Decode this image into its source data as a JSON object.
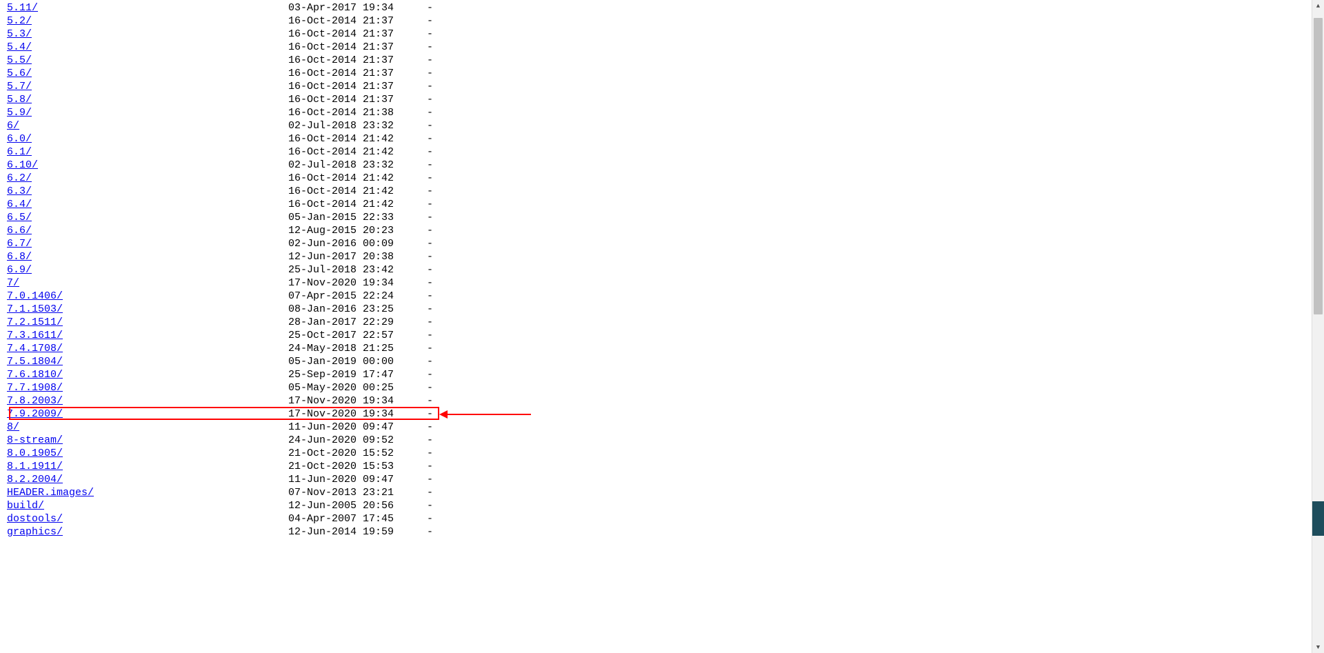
{
  "listing": [
    {
      "name": "5.11/",
      "date": "03-Apr-2017 19:34",
      "size": "-",
      "highlighted": false
    },
    {
      "name": "5.2/",
      "date": "16-Oct-2014 21:37",
      "size": "-",
      "highlighted": false
    },
    {
      "name": "5.3/",
      "date": "16-Oct-2014 21:37",
      "size": "-",
      "highlighted": false
    },
    {
      "name": "5.4/",
      "date": "16-Oct-2014 21:37",
      "size": "-",
      "highlighted": false
    },
    {
      "name": "5.5/",
      "date": "16-Oct-2014 21:37",
      "size": "-",
      "highlighted": false
    },
    {
      "name": "5.6/",
      "date": "16-Oct-2014 21:37",
      "size": "-",
      "highlighted": false
    },
    {
      "name": "5.7/",
      "date": "16-Oct-2014 21:37",
      "size": "-",
      "highlighted": false
    },
    {
      "name": "5.8/",
      "date": "16-Oct-2014 21:37",
      "size": "-",
      "highlighted": false
    },
    {
      "name": "5.9/",
      "date": "16-Oct-2014 21:38",
      "size": "-",
      "highlighted": false
    },
    {
      "name": "6/",
      "date": "02-Jul-2018 23:32",
      "size": "-",
      "highlighted": false
    },
    {
      "name": "6.0/",
      "date": "16-Oct-2014 21:42",
      "size": "-",
      "highlighted": false
    },
    {
      "name": "6.1/",
      "date": "16-Oct-2014 21:42",
      "size": "-",
      "highlighted": false
    },
    {
      "name": "6.10/",
      "date": "02-Jul-2018 23:32",
      "size": "-",
      "highlighted": false
    },
    {
      "name": "6.2/",
      "date": "16-Oct-2014 21:42",
      "size": "-",
      "highlighted": false
    },
    {
      "name": "6.3/",
      "date": "16-Oct-2014 21:42",
      "size": "-",
      "highlighted": false
    },
    {
      "name": "6.4/",
      "date": "16-Oct-2014 21:42",
      "size": "-",
      "highlighted": false
    },
    {
      "name": "6.5/",
      "date": "05-Jan-2015 22:33",
      "size": "-",
      "highlighted": false
    },
    {
      "name": "6.6/",
      "date": "12-Aug-2015 20:23",
      "size": "-",
      "highlighted": false
    },
    {
      "name": "6.7/",
      "date": "02-Jun-2016 00:09",
      "size": "-",
      "highlighted": false
    },
    {
      "name": "6.8/",
      "date": "12-Jun-2017 20:38",
      "size": "-",
      "highlighted": false
    },
    {
      "name": "6.9/",
      "date": "25-Jul-2018 23:42",
      "size": "-",
      "highlighted": false
    },
    {
      "name": "7/",
      "date": "17-Nov-2020 19:34",
      "size": "-",
      "highlighted": false
    },
    {
      "name": "7.0.1406/",
      "date": "07-Apr-2015 22:24",
      "size": "-",
      "highlighted": false
    },
    {
      "name": "7.1.1503/",
      "date": "08-Jan-2016 23:25",
      "size": "-",
      "highlighted": false
    },
    {
      "name": "7.2.1511/",
      "date": "28-Jan-2017 22:29",
      "size": "-",
      "highlighted": false
    },
    {
      "name": "7.3.1611/",
      "date": "25-Oct-2017 22:57",
      "size": "-",
      "highlighted": false
    },
    {
      "name": "7.4.1708/",
      "date": "24-May-2018 21:25",
      "size": "-",
      "highlighted": false
    },
    {
      "name": "7.5.1804/",
      "date": "05-Jan-2019 00:00",
      "size": "-",
      "highlighted": false
    },
    {
      "name": "7.6.1810/",
      "date": "25-Sep-2019 17:47",
      "size": "-",
      "highlighted": false
    },
    {
      "name": "7.7.1908/",
      "date": "05-May-2020 00:25",
      "size": "-",
      "highlighted": false
    },
    {
      "name": "7.8.2003/",
      "date": "17-Nov-2020 19:34",
      "size": "-",
      "highlighted": false
    },
    {
      "name": "7.9.2009/",
      "date": "17-Nov-2020 19:34",
      "size": "-",
      "highlighted": true
    },
    {
      "name": "8/",
      "date": "11-Jun-2020 09:47",
      "size": "-",
      "highlighted": false
    },
    {
      "name": "8-stream/",
      "date": "24-Jun-2020 09:52",
      "size": "-",
      "highlighted": false
    },
    {
      "name": "8.0.1905/",
      "date": "21-Oct-2020 15:52",
      "size": "-",
      "highlighted": false
    },
    {
      "name": "8.1.1911/",
      "date": "21-Oct-2020 15:53",
      "size": "-",
      "highlighted": false
    },
    {
      "name": "8.2.2004/",
      "date": "11-Jun-2020 09:47",
      "size": "-",
      "highlighted": false
    },
    {
      "name": "HEADER.images/",
      "date": "07-Nov-2013 23:21",
      "size": "-",
      "highlighted": false
    },
    {
      "name": "build/",
      "date": "12-Jun-2005 20:56",
      "size": "-",
      "highlighted": false
    },
    {
      "name": "dostools/",
      "date": "04-Apr-2007 17:45",
      "size": "-",
      "highlighted": false
    },
    {
      "name": "graphics/",
      "date": "12-Jun-2014 19:59",
      "size": "-",
      "highlighted": false
    }
  ]
}
